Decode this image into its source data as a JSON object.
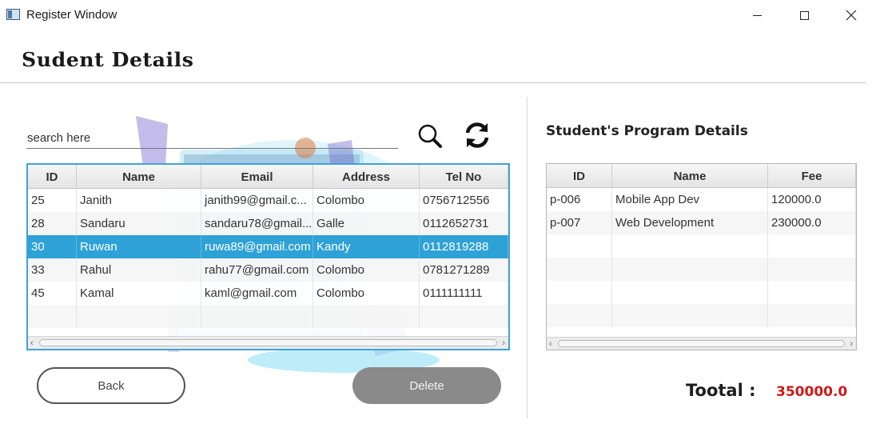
{
  "window": {
    "title": "Register Window",
    "icon": "app-window-icon"
  },
  "page": {
    "title": "Sudent Details"
  },
  "search": {
    "placeholder": "search here",
    "value": "",
    "search_icon": "magnifier-icon",
    "refresh_icon": "refresh-icon"
  },
  "students_table": {
    "columns": [
      "ID",
      "Name",
      "Email",
      "Address",
      "Tel No"
    ],
    "rows": [
      [
        "25",
        "Janith",
        "janith99@gmail.c...",
        "Colombo",
        "0756712556"
      ],
      [
        "28",
        "Sandaru",
        "sandaru78@gmail....",
        "Galle",
        "0112652731"
      ],
      [
        "30",
        "Ruwan",
        "ruwa89@gmail.com",
        "Kandy",
        "0112819288"
      ],
      [
        "33",
        "Rahul",
        "rahu77@gmail.com",
        "Colombo",
        "0781271289"
      ],
      [
        "45",
        "Kamal",
        "kaml@gmail.com",
        "Colombo",
        "0111111111"
      ]
    ],
    "selected_row": 2
  },
  "program_section": {
    "title": "Student's Program Details"
  },
  "programs_table": {
    "columns": [
      "ID",
      "Name",
      "Fee"
    ],
    "rows": [
      [
        "p-006",
        "Mobile App Dev",
        "120000.0"
      ],
      [
        "p-007",
        "Web Development",
        "230000.0"
      ]
    ]
  },
  "total": {
    "label": "Tootal  :",
    "value": "350000.0"
  },
  "buttons": {
    "back": "Back",
    "delete": "Delete"
  },
  "colors": {
    "selection": "#2ea2d6",
    "table_focus_border": "#3fa3da",
    "total_value": "#d01818",
    "delete_button": "#8a8a8a"
  }
}
